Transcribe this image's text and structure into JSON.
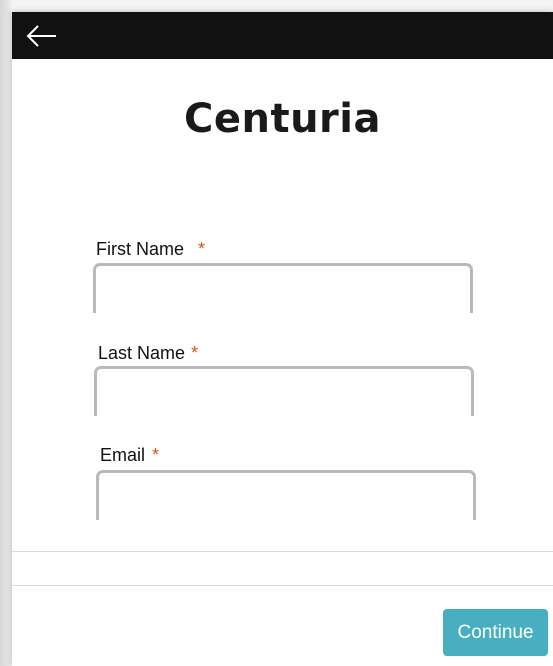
{
  "header": {
    "back_icon": "arrow-left-icon",
    "background": "#111111"
  },
  "brand": {
    "logo_text": "Centuria"
  },
  "form": {
    "first_name": {
      "label": "First Name",
      "required_marker": "*",
      "value": ""
    },
    "last_name": {
      "label": "Last Name",
      "required_marker": "*",
      "value": ""
    },
    "email": {
      "label": "Email",
      "required_marker": "*",
      "value": ""
    }
  },
  "footer": {
    "continue_label": "Continue",
    "continue_color": "#48afc1"
  },
  "colors": {
    "required": "#e0541a",
    "field_border": "#b9b9b9"
  }
}
